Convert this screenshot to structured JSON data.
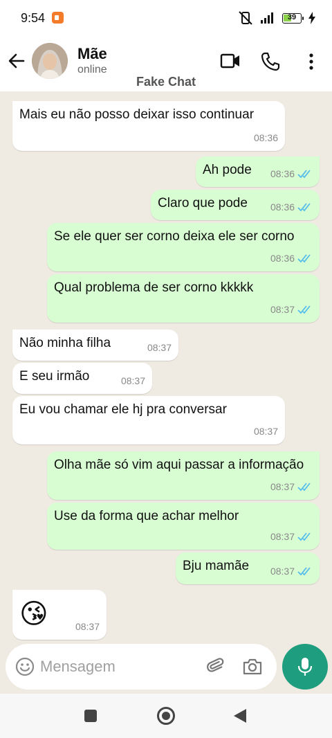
{
  "status": {
    "time": "9:54",
    "battery": "39"
  },
  "header": {
    "contact_name": "Mãe",
    "contact_status": "online",
    "watermark": "Fake Chat"
  },
  "messages": [
    {
      "dir": "in",
      "text": "Mais eu não posso deixar isso continuar",
      "time": "08:36"
    },
    {
      "dir": "out",
      "text": "Ah pode",
      "time": "08:36"
    },
    {
      "dir": "out",
      "text": "Claro que pode",
      "time": "08:36"
    },
    {
      "dir": "out",
      "text": "Se ele quer ser corno deixa ele ser corno",
      "time": "08:36"
    },
    {
      "dir": "out",
      "text": "Qual problema de ser corno kkkkk",
      "time": "08:37"
    },
    {
      "dir": "in",
      "text": "Não minha filha",
      "time": "08:37"
    },
    {
      "dir": "in",
      "text": "E seu irmão",
      "time": "08:37"
    },
    {
      "dir": "in",
      "text": "Eu vou chamar ele hj pra conversar",
      "time": "08:37"
    },
    {
      "dir": "out",
      "text": "Olha mãe só vim aqui passar a informação",
      "time": "08:37"
    },
    {
      "dir": "out",
      "text": "Use da forma que achar melhor",
      "time": "08:37"
    },
    {
      "dir": "out",
      "text": "Bju mamãe",
      "time": "08:37"
    },
    {
      "dir": "in",
      "text": "😘",
      "time": "08:37"
    }
  ],
  "composer": {
    "placeholder": "Mensagem"
  },
  "colors": {
    "outgoing_bubble": "#d9fdd3",
    "incoming_bubble": "#ffffff",
    "accent": "#1e9e7e",
    "read_ticks": "#53bdeb",
    "chat_background": "#efeae2"
  },
  "icons": [
    "back-arrow-icon",
    "video-call-icon",
    "phone-icon",
    "more-vert-icon",
    "emoji-icon",
    "attach-icon",
    "camera-icon",
    "mic-icon"
  ]
}
